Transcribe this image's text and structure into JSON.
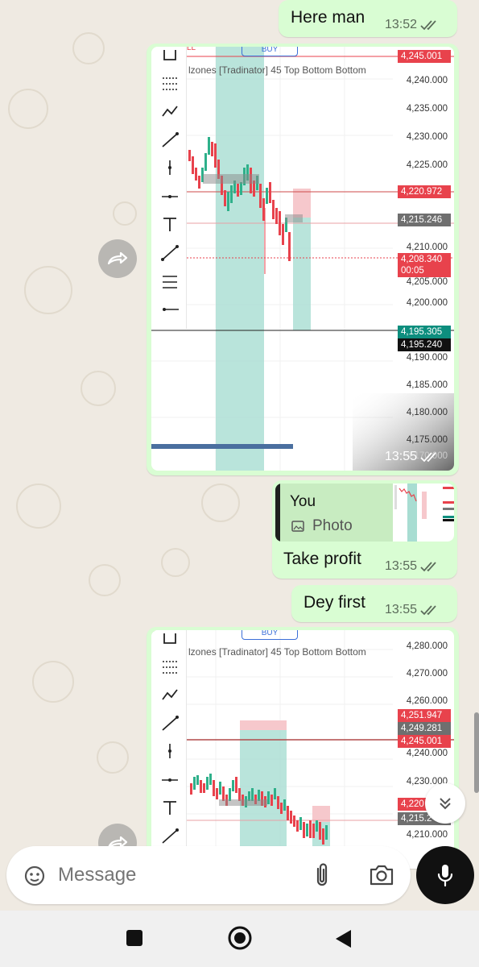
{
  "chat": {
    "messages": {
      "m1": {
        "text": "Here man",
        "time": "13:52"
      },
      "m2": {
        "time": "13:55"
      },
      "m3": {
        "quote_author": "You",
        "quote_type": "Photo",
        "text": "Take profit",
        "time": "13:55"
      },
      "m4": {
        "text": "Dey first",
        "time": "13:55"
      }
    }
  },
  "chart1": {
    "header": "lzones [Tradinator] 45 Top Bottom Bottom",
    "buy_label": "BUY",
    "sell_label": "LL",
    "axis_labels": [
      "4,240.000",
      "4,235.000",
      "4,230.000",
      "4,225.000",
      "4,210.000",
      "4,205.000",
      "4,200.000",
      "4,190.000",
      "4,185.000",
      "4,180.000",
      "4,175.000",
      "4,170.000"
    ],
    "price_tags": {
      "t1": "4,245.001",
      "t2": "4,220.972",
      "t3": "4,215.246",
      "t4a": "4,208.340",
      "t4b": "00:05",
      "t5": "4,195.305",
      "t6": "4,195.240"
    }
  },
  "chart2": {
    "header": "lzones [Tradinator] 45 Top Bottom Bottom",
    "buy_label": "BUY",
    "axis_labels": [
      "4,280.000",
      "4,270.000",
      "4,260.000",
      "4,240.000",
      "4,230.000",
      "4,210.000"
    ],
    "price_tags": {
      "t1": "4,251.947",
      "t2": "4,249.281",
      "t3": "4,245.001",
      "t4": "4,220",
      "t5": "4,215.2"
    }
  },
  "input": {
    "placeholder": "Message"
  },
  "colors": {
    "bubble": "#d9fdd3",
    "bg": "#efeae2",
    "tag_red": "#e8424c",
    "tag_gray": "#6f6f6f",
    "tag_teal": "#0d8e7e",
    "zone_teal": "#a8ddd2",
    "zone_pink": "#f6c8cc"
  },
  "icons": [
    "double-check-icon",
    "forward-icon",
    "sticker-icon",
    "attach-icon",
    "camera-icon",
    "mic-icon",
    "scroll-down-icon",
    "nav-square-icon",
    "nav-home-icon",
    "nav-back-icon"
  ]
}
